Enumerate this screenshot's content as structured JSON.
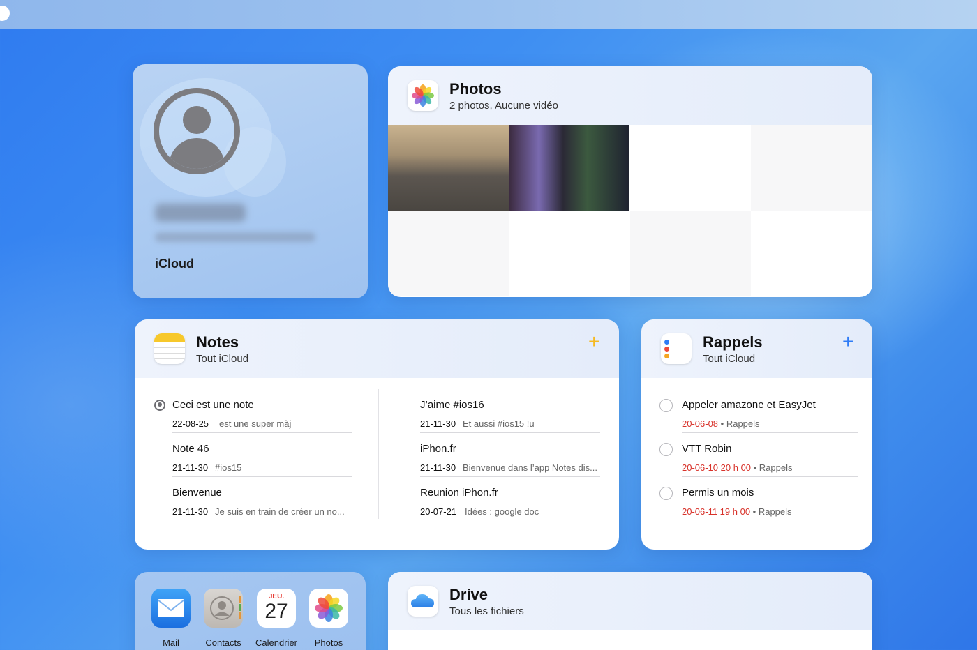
{
  "colors": {
    "notes_accent": "#f5b921",
    "reminders_accent": "#2f7cf6",
    "reminder_date": "#d8322a"
  },
  "profile": {
    "label": "iCloud",
    "avatar_icon": "person-circle-icon"
  },
  "photos": {
    "title": "Photos",
    "subtitle": "2 photos, Aucune vidéo",
    "icon": "photos-flower-icon"
  },
  "notes": {
    "title": "Notes",
    "subtitle": "Tout iCloud",
    "icon": "notes-icon",
    "add_label": "+",
    "left": [
      {
        "title": "Ceci est une note",
        "date": "22-08-25",
        "preview": "est une super màj",
        "shared_icon": "person-circle-icon"
      },
      {
        "title": "Note 46",
        "date": "21-11-30",
        "preview": "#ios15"
      },
      {
        "title": "Bienvenue",
        "date": "21-11-30",
        "preview": "Je suis en train de créer un no..."
      }
    ],
    "right": [
      {
        "title": "J’aime #ios16",
        "date": "21-11-30",
        "preview": "Et aussi #ios15 !u"
      },
      {
        "title": "iPhon.fr",
        "date": "21-11-30",
        "preview": "Bienvenue dans l’app Notes dis..."
      },
      {
        "title": "Reunion iPhon.fr",
        "date": "20-07-21",
        "preview": "Idées : google doc"
      }
    ]
  },
  "reminders": {
    "title": "Rappels",
    "subtitle": "Tout iCloud",
    "icon": "reminders-icon",
    "add_label": "+",
    "items": [
      {
        "title": "Appeler amazone et EasyJet",
        "date": "20-06-08",
        "list": " • Rappels"
      },
      {
        "title": "VTT Robin",
        "date": "20-06-10 20 h 00",
        "list": " • Rappels"
      },
      {
        "title": "Permis un mois",
        "date": "20-06-11 19 h 00",
        "list": " • Rappels"
      }
    ]
  },
  "dock": {
    "apps": [
      {
        "label": "Mail",
        "icon": "mail-icon"
      },
      {
        "label": "Contacts",
        "icon": "contacts-icon"
      },
      {
        "label": "Calendrier",
        "icon": "calendar-icon",
        "weekday": "JEU.",
        "day": "27"
      },
      {
        "label": "Photos",
        "icon": "photos-flower-icon"
      }
    ]
  },
  "drive": {
    "title": "Drive",
    "subtitle": "Tous les fichiers",
    "icon": "icloud-drive-icon"
  }
}
